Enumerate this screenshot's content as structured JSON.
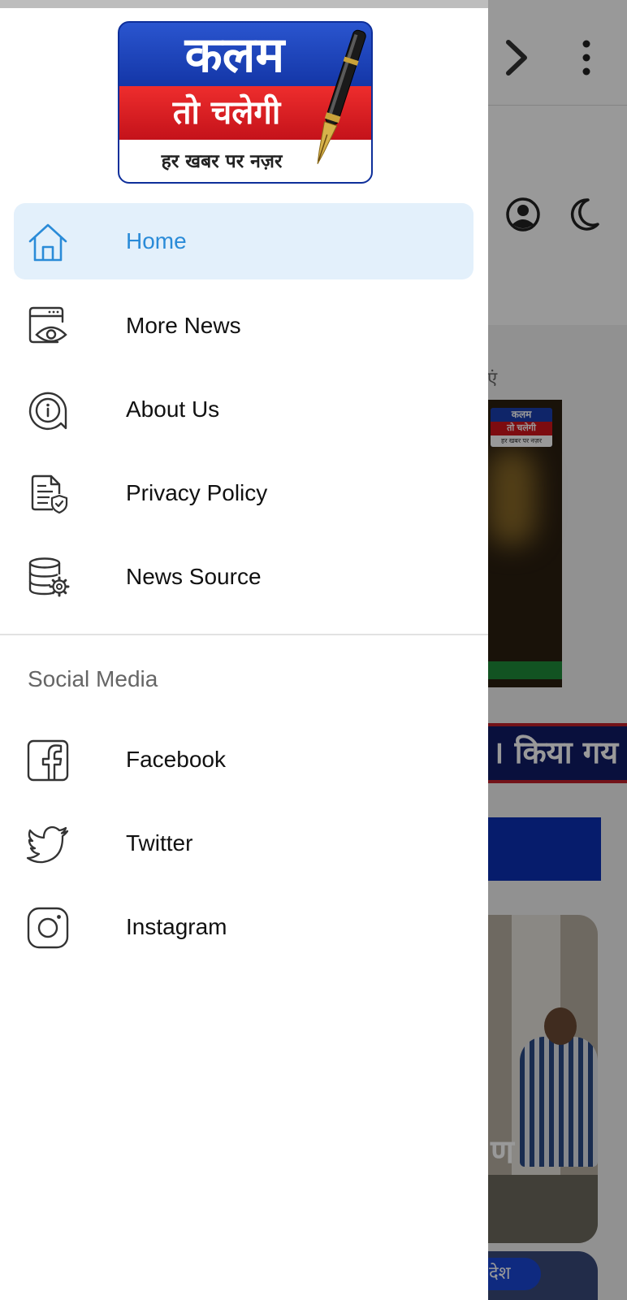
{
  "app": {
    "logo": {
      "line1": "कलम",
      "line2": "तो चलेगी",
      "tagline": "हर खबर पर नज़र",
      "colors": {
        "blue": "#1a3fb0",
        "red": "#d0141c",
        "white": "#ffffff"
      }
    }
  },
  "drawer": {
    "menu": [
      {
        "label": "Home",
        "icon": "home-icon",
        "active": true
      },
      {
        "label": "More News",
        "icon": "browser-eye-icon",
        "active": false
      },
      {
        "label": "About Us",
        "icon": "info-chat-icon",
        "active": false
      },
      {
        "label": "Privacy Policy",
        "icon": "document-shield-icon",
        "active": false
      },
      {
        "label": "News Source",
        "icon": "database-gear-icon",
        "active": false
      }
    ],
    "social_title": "Social Media",
    "social": [
      {
        "label": "Facebook",
        "icon": "facebook-icon"
      },
      {
        "label": "Twitter",
        "icon": "twitter-icon"
      },
      {
        "label": "Instagram",
        "icon": "instagram-icon"
      }
    ],
    "accent_color": "#2a8bd8",
    "active_bg": "#e3f0fb"
  },
  "background": {
    "hint_text": "एं",
    "mini_logo": {
      "line1": "कलम",
      "line2": "तो चलेगी",
      "line3": "हर खबर पर नज़र"
    },
    "ticker_text": "। किया गय",
    "photo_text": "ण",
    "pill_text": "देश"
  }
}
